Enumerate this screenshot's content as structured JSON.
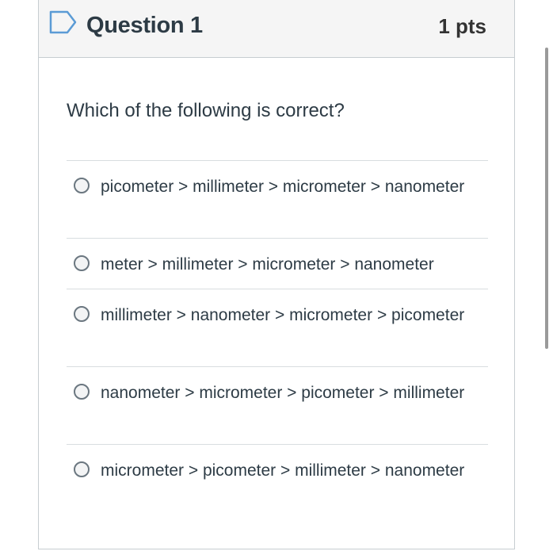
{
  "question": {
    "title": "Question 1",
    "points": "1 pts",
    "prompt": "Which of the following is correct?"
  },
  "answers": [
    {
      "label": "picometer > millimeter > micrometer > nanometer"
    },
    {
      "label": "meter > millimeter > micrometer > nanometer"
    },
    {
      "label": "millimeter > nanometer > micrometer > picometer"
    },
    {
      "label": "nanometer > micrometer > picometer > millimeter"
    },
    {
      "label": "micrometer > picometer > millimeter > nanometer"
    }
  ],
  "colors": {
    "flag_icon": "#5b9bd5",
    "header_bg": "#f5f5f5",
    "text": "#2d3b45",
    "border": "#c7cdd1"
  },
  "icons": {
    "flag": "flag-icon",
    "radio": "radio-circle"
  }
}
